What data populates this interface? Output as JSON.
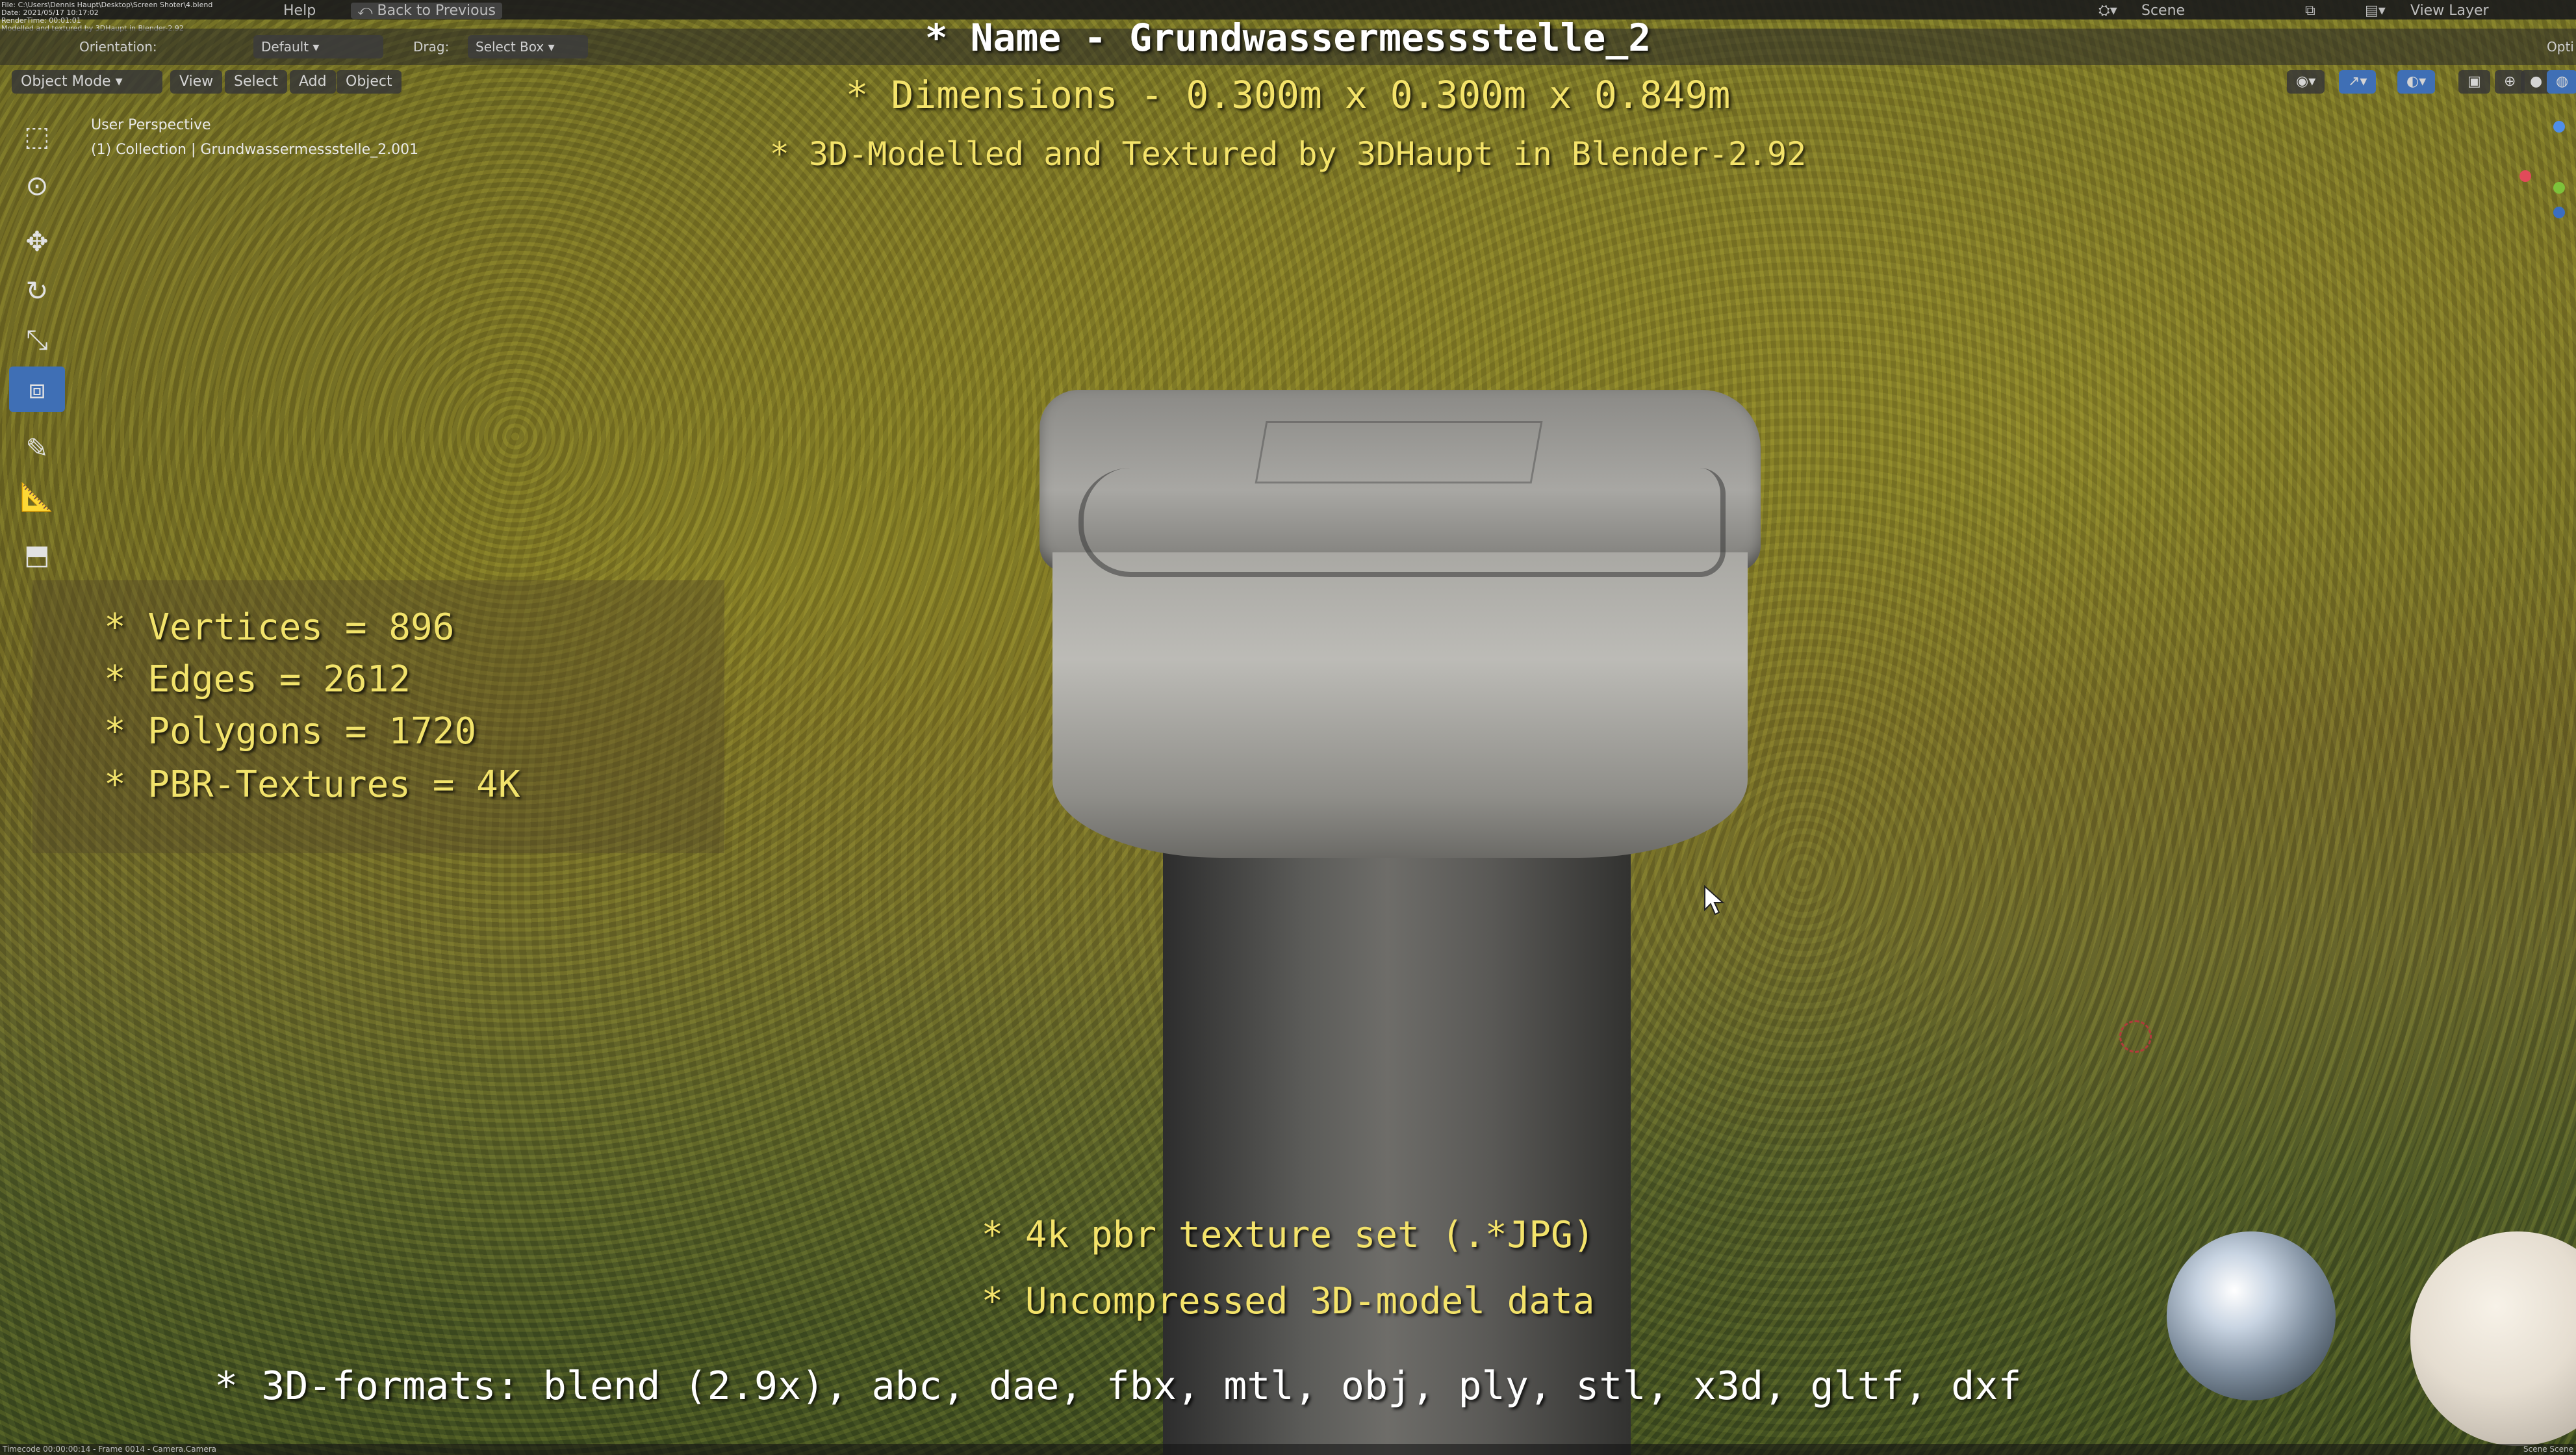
{
  "topbar": {
    "info_lines": [
      "File: C:\\Users\\Dennis Haupt\\Desktop\\Screen Shoter\\4.blend",
      "Date: 2021/05/17 10:17:02",
      "RenderTime: 00:01:01",
      "Modelled and textured by 3DHaupt in Blender-2.92"
    ],
    "help": "Help",
    "back_to_previous": "Back to Previous",
    "scene": "Scene",
    "view_layer": "View Layer"
  },
  "toolbar2": {
    "orientation_label": "Orientation:",
    "orientation_value": "Default",
    "drag_label": "Drag:",
    "drag_value": "Select Box",
    "options": "Opti"
  },
  "header": {
    "mode": "Object Mode",
    "menus": [
      "View",
      "Select",
      "Add",
      "Object"
    ]
  },
  "viewport_info": {
    "perspective": "User Perspective",
    "collection": "(1) Collection | Grundwassermessstelle_2.001"
  },
  "overlay": {
    "name": "* Name - Grundwassermessstelle_2",
    "dimensions": "* Dimensions -  0.300m x 0.300m x 0.849m",
    "credit": "* 3D-Modelled and Textured by 3DHaupt in Blender-2.92",
    "stats": [
      "* Vertices = 896",
      "* Edges = 2612",
      "* Polygons = 1720",
      "* PBR-Textures = 4K"
    ],
    "feature_1": "* 4k pbr texture set (.*JPG)",
    "feature_2": "* Uncompressed 3D-model data",
    "formats": "* 3D-formats: blend (2.9x), abc, dae, fbx, mtl, obj, ply, stl, x3d, gltf, dxf"
  },
  "footer": {
    "left": "Timecode 00:00:00:14 - Frame 0014 - Camera.Camera",
    "right": "Scene Scene"
  },
  "colors": {
    "overlay_yellow": "#f4e36a",
    "active_tool_blue": "#3f6fb5"
  }
}
